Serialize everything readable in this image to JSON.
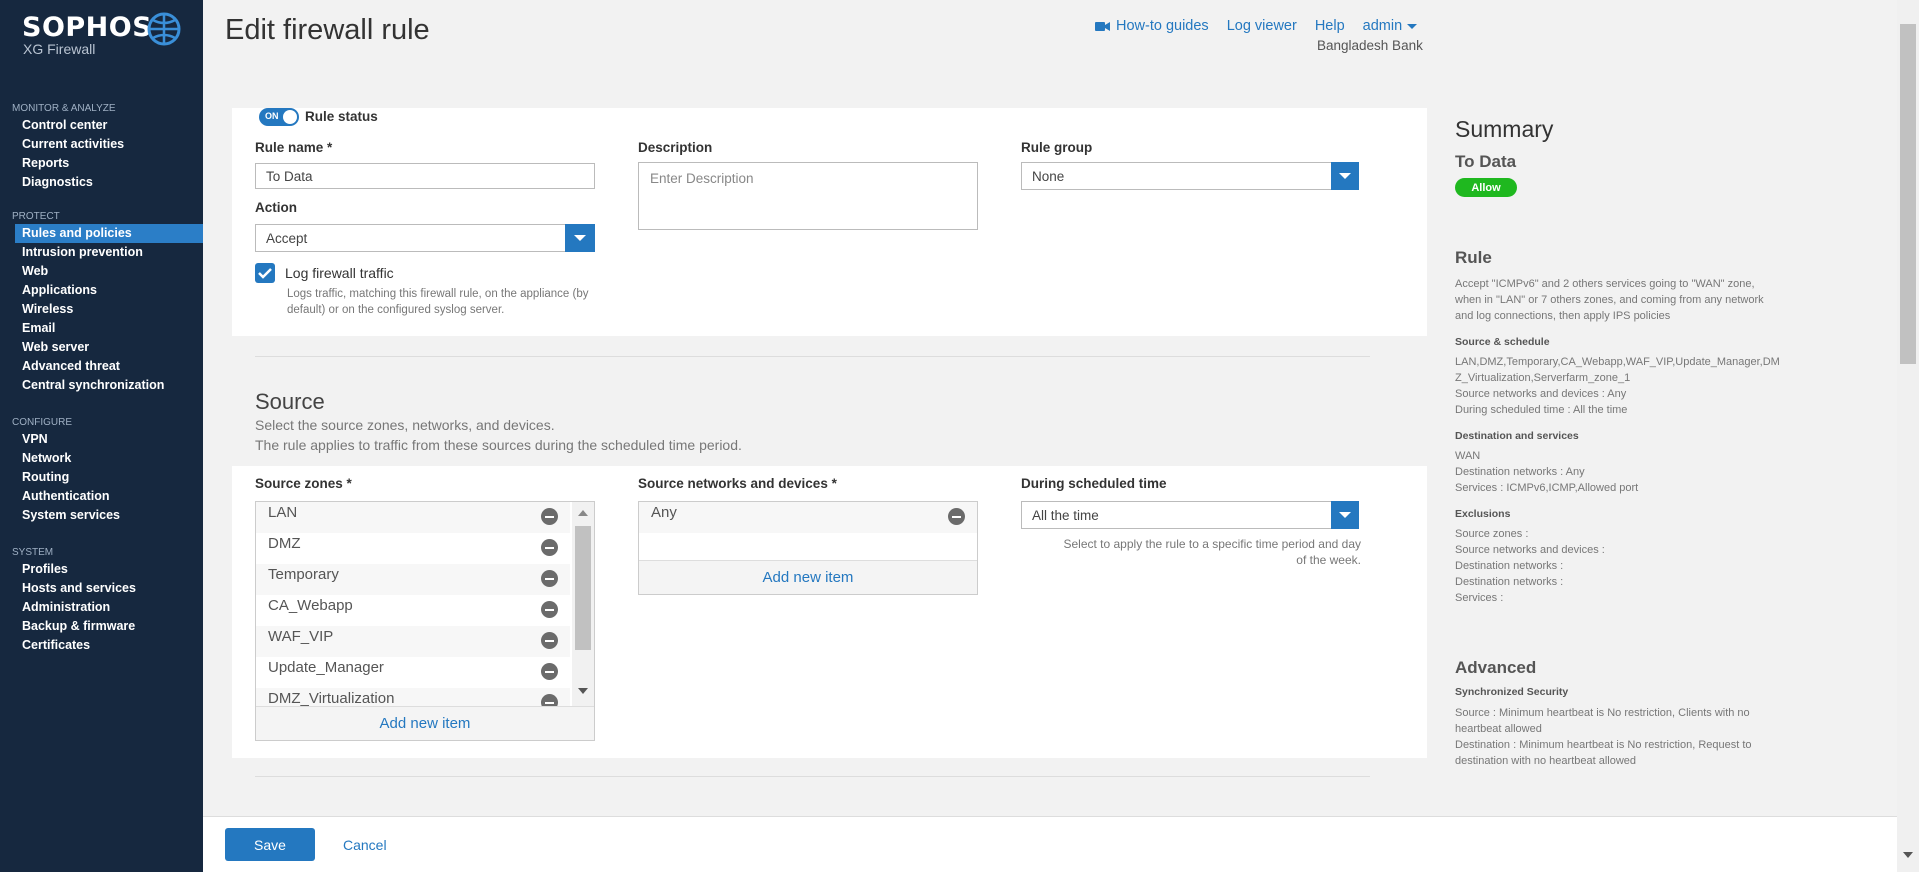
{
  "brand": {
    "name": "SOPHOS",
    "product": "XG Firewall"
  },
  "sidebar": {
    "sections": [
      {
        "title": "MONITOR & ANALYZE",
        "items": [
          "Control center",
          "Current activities",
          "Reports",
          "Diagnostics"
        ]
      },
      {
        "title": "PROTECT",
        "items": [
          "Rules and policies",
          "Intrusion prevention",
          "Web",
          "Applications",
          "Wireless",
          "Email",
          "Web server",
          "Advanced threat",
          "Central synchronization"
        ]
      },
      {
        "title": "CONFIGURE",
        "items": [
          "VPN",
          "Network",
          "Routing",
          "Authentication",
          "System services"
        ]
      },
      {
        "title": "SYSTEM",
        "items": [
          "Profiles",
          "Hosts and services",
          "Administration",
          "Backup & firmware",
          "Certificates"
        ]
      }
    ],
    "active": "Rules and policies"
  },
  "header": {
    "title": "Edit firewall rule",
    "links": {
      "howto": "How-to guides",
      "logviewer": "Log viewer",
      "help": "Help",
      "admin": "admin"
    },
    "org": "Bangladesh Bank"
  },
  "rule": {
    "status_toggle": "ON",
    "status_label": "Rule status",
    "name_label": "Rule name *",
    "name_value": "To Data",
    "description_label": "Description",
    "description_placeholder": "Enter Description",
    "group_label": "Rule group",
    "group_value": "None",
    "action_label": "Action",
    "action_value": "Accept",
    "log_label": "Log firewall traffic",
    "log_help": "Logs traffic, matching this firewall rule, on the appliance (by default) or on the configured syslog server.",
    "log_checked": true
  },
  "source": {
    "title": "Source",
    "desc1": "Select the source zones, networks, and devices.",
    "desc2": "The rule applies to traffic from these sources during the scheduled time period.",
    "zones_label": "Source zones *",
    "zones": [
      "LAN",
      "DMZ",
      "Temporary",
      "CA_Webapp",
      "WAF_VIP",
      "Update_Manager",
      "DMZ_Virtualization"
    ],
    "add_item": "Add new item",
    "networks_label": "Source networks and devices *",
    "networks": [
      "Any"
    ],
    "schedule_label": "During scheduled time",
    "schedule_value": "All the time",
    "schedule_help": "Select to apply the rule to a specific time period and day of the week."
  },
  "summary": {
    "title": "Summary",
    "rule_name": "To Data",
    "badge": "Allow",
    "rule_heading": "Rule",
    "rule_text": "Accept \"ICMPv6\" and 2 others services going to \"WAN\" zone, when in \"LAN\" or 7 others zones, and coming from any network and log connections, then apply IPS policies",
    "src_heading": "Source & schedule",
    "src_zones": "LAN,DMZ,Temporary,CA_Webapp,WAF_VIP,Update_Manager,DMZ_Virtualization,Serverfarm_zone_1",
    "src_networks": "Source networks and devices : Any",
    "src_time": "During scheduled time : All the time",
    "dst_heading": "Destination and services",
    "dst_zone": "WAN",
    "dst_networks": "Destination networks : Any",
    "dst_services": "Services : ICMPv6,ICMP,Allowed port",
    "exc_heading": "Exclusions",
    "exc_src_zones": "Source zones :",
    "exc_src_networks": "Source networks and devices :",
    "exc_dst_networks1": "Destination networks :",
    "exc_dst_networks2": "Destination networks :",
    "exc_services": "Services :",
    "adv_heading": "Advanced",
    "sync_heading": "Synchronized Security",
    "sync_source": "Source : Minimum heartbeat is No restriction, Clients with no heartbeat allowed",
    "sync_dest": "Destination : Minimum heartbeat is No restriction, Request to destination with no heartbeat allowed"
  },
  "footer": {
    "save": "Save",
    "cancel": "Cancel"
  },
  "colors": {
    "sidebar": "#16283f",
    "accent": "#2478c0",
    "allow": "#1fb81f"
  }
}
